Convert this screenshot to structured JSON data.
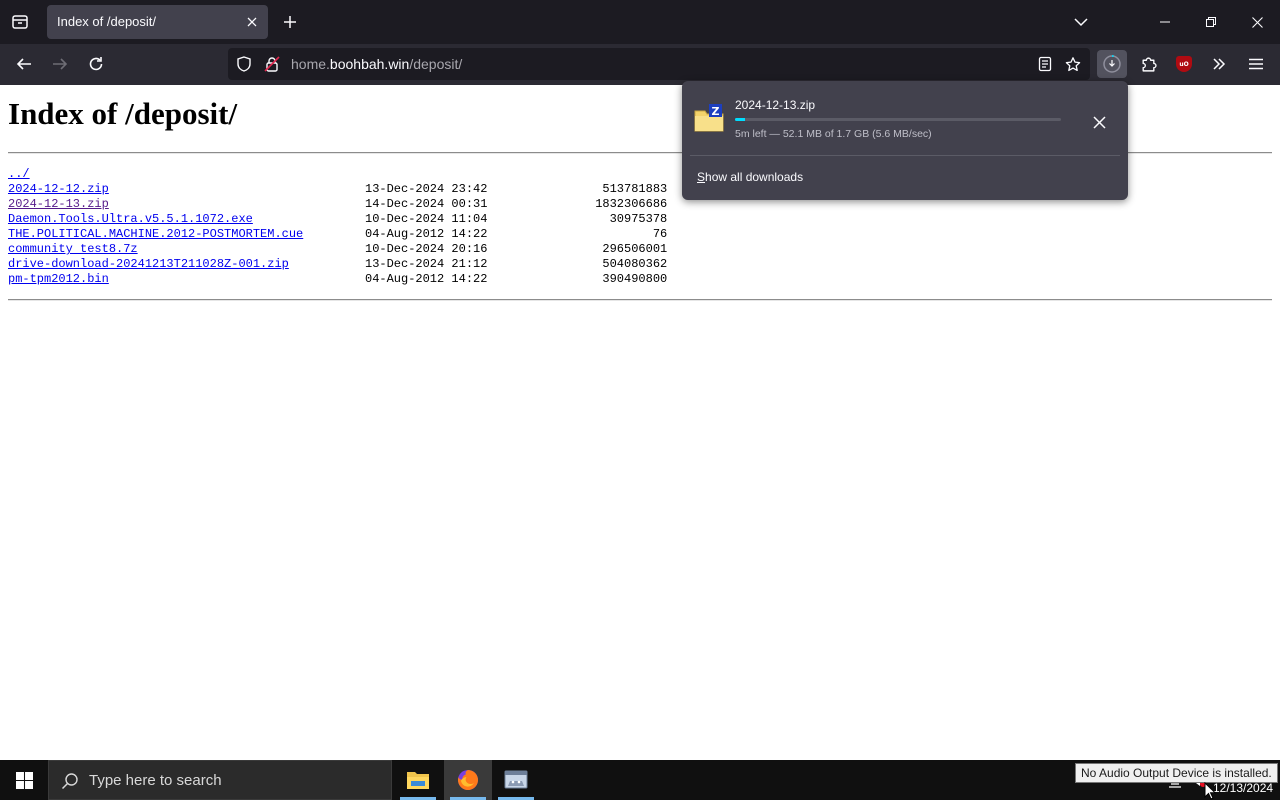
{
  "browser": {
    "tab": {
      "title": "Index of /deposit/"
    },
    "url": {
      "host": "home.boohbah.win",
      "path_before": "home.",
      "host_main": "boohbah.win",
      "path": "/deposit/"
    }
  },
  "page": {
    "heading": "Index of /deposit/",
    "parent_link": "../",
    "files": [
      {
        "name": "2024-12-12.zip",
        "date": "13-Dec-2024 23:42",
        "size": "513781883",
        "visited": false
      },
      {
        "name": "2024-12-13.zip",
        "date": "14-Dec-2024 00:31",
        "size": "1832306686",
        "visited": true
      },
      {
        "name": "Daemon.Tools.Ultra.v5.5.1.1072.exe",
        "date": "10-Dec-2024 11:04",
        "size": "30975378",
        "visited": false
      },
      {
        "name": "THE.POLITICAL.MACHINE.2012-POSTMORTEM.cue",
        "date": "04-Aug-2012 14:22",
        "size": "76",
        "visited": false
      },
      {
        "name": "community test8.7z",
        "date": "10-Dec-2024 20:16",
        "size": "296506001",
        "visited": false
      },
      {
        "name": "drive-download-20241213T211028Z-001.zip",
        "date": "13-Dec-2024 21:12",
        "size": "504080362",
        "visited": false
      },
      {
        "name": "pm-tpm2012.bin",
        "date": "04-Aug-2012 14:22",
        "size": "390490800",
        "visited": false
      }
    ]
  },
  "downloads": {
    "item_name": "2024-12-13.zip",
    "status": "5m left — 52.1 MB of 1.7 GB (5.6 MB/sec)",
    "progress": 0.03,
    "show_all_prefix": "S",
    "show_all_rest": "how all downloads",
    "accent": "#00ddff"
  },
  "taskbar": {
    "search_placeholder": "Type here to search",
    "date": "12/13/2024",
    "tooltip": "No Audio Output Device is installed."
  }
}
